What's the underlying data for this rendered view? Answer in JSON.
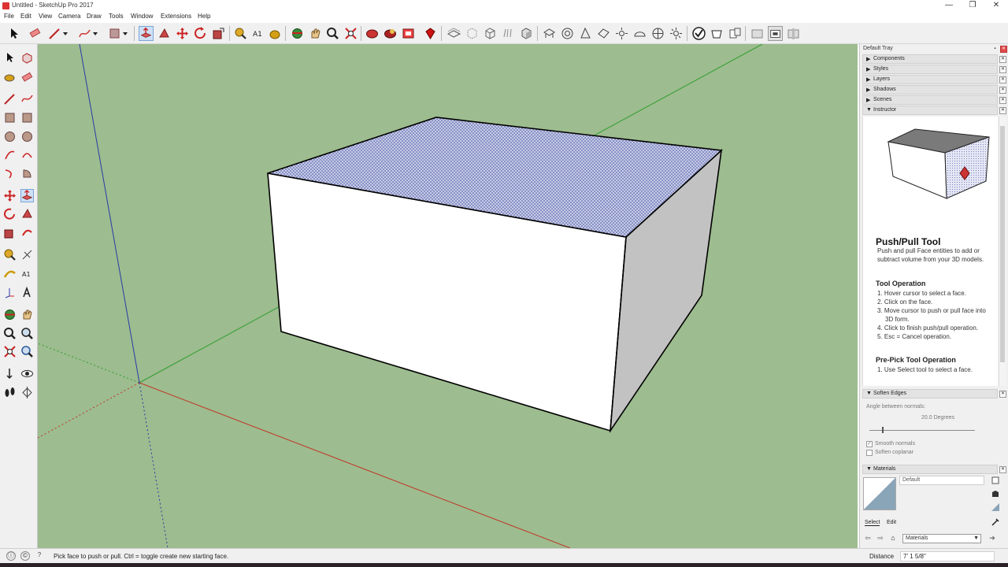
{
  "window": {
    "title": "Untitled - SketchUp Pro 2017",
    "minimize": "—",
    "restore": "❐",
    "close": "✕"
  },
  "menu": [
    "File",
    "Edit",
    "View",
    "Camera",
    "Draw",
    "Tools",
    "Window",
    "Extensions",
    "Help"
  ],
  "toolbar_icons": [
    "select-icon",
    "eraser-icon",
    "line-icon",
    "line-dropdown-icon",
    "freehand-icon",
    "arc-dropdown-icon",
    "paint-bucket-icon",
    "paint-dropdown-icon",
    "push-pull-icon",
    "follow-me-icon",
    "move-icon",
    "rotate-icon",
    "scale-icon",
    "tape-measure-icon",
    "text-icon",
    "paint-icon",
    "orbit-icon",
    "pan-icon",
    "zoom-icon",
    "zoom-extents-icon",
    "warehouse-icon",
    "extension-warehouse-icon",
    "layout-icon",
    "ruby-icon",
    "xray-icon",
    "back-edges-icon",
    "wireframe-icon",
    "hidden-line-icon",
    "shaded-icon",
    "shaded-textures-icon",
    "monochrome-icon",
    "iso-view-icon",
    "top-view-icon",
    "front-view-icon",
    "right-view-icon",
    "back-view-icon",
    "left-view-icon",
    "bottom-view-icon",
    "sandbox-icon",
    "solid-tools-icon",
    "section-plane-icon",
    "section-display-icon",
    "section-cut-icon"
  ],
  "left_tool_icons": [
    "select-icon",
    "make-component-icon",
    "paint-bucket-icon",
    "eraser-icon",
    "line-icon",
    "freehand-icon",
    "rectangle-icon",
    "rotated-rectangle-icon",
    "circle-icon",
    "polygon-icon",
    "arc-icon",
    "two-point-arc-icon",
    "three-point-arc-icon",
    "pie-icon",
    "move-icon",
    "push-pull-icon",
    "rotate-icon",
    "follow-me-icon",
    "scale-icon",
    "offset-icon",
    "tape-measure-icon",
    "dimension-icon",
    "protractor-icon",
    "text-icon",
    "axes-icon",
    "3d-text-icon",
    "orbit-icon",
    "pan-icon",
    "zoom-icon",
    "zoom-window-icon",
    "zoom-extents-icon",
    "previous-view-icon",
    "position-camera-icon",
    "look-around-icon",
    "walk-icon",
    "section-plane-icon"
  ],
  "tray": {
    "title": "Default Tray",
    "panels": [
      {
        "label": "Components",
        "expanded": false
      },
      {
        "label": "Styles",
        "expanded": false
      },
      {
        "label": "Layers",
        "expanded": false
      },
      {
        "label": "Shadows",
        "expanded": false
      },
      {
        "label": "Scenes",
        "expanded": false
      },
      {
        "label": "Instructor",
        "expanded": true
      }
    ],
    "instructor": {
      "title": "Push/Pull Tool",
      "description": "Push and pull Face entities to add or subtract volume from your 3D models.",
      "op_heading": "Tool Operation",
      "steps": [
        "1. Hover cursor to select a face.",
        "2. Click on the face.",
        "3. Move cursor to push or pull face into 3D form.",
        "4. Click to finish push/pull operation.",
        "5. Esc = Cancel operation."
      ],
      "prepick_heading": "Pre-Pick Tool Operation",
      "prepick_steps": [
        "1. Use Select tool to select a face."
      ]
    },
    "soften_edges": {
      "label": "Soften Edges",
      "angle_label": "Angle between normals:",
      "angle_value": "20.0 Degrees",
      "smooth_normals": "Smooth normals",
      "soften_coplanar": "Soften coplanar",
      "smooth_checked": true,
      "coplanar_checked": false,
      "slider_value_degrees": 20
    },
    "materials": {
      "label": "Materials",
      "name": "Default",
      "tab_select": "Select",
      "tab_edit": "Edit",
      "library": "Materials"
    }
  },
  "status": {
    "text": "Pick face to push or pull.  Ctrl = toggle create new starting face.",
    "measurements_label": "Distance",
    "measurements_value": "7' 1 5/8\""
  },
  "colors": {
    "viewport_bg": "#9dbc8f",
    "axis_red": "#c0392b",
    "axis_green": "#2f9e2f",
    "axis_blue": "#2a3aa8",
    "selected_face": "#b9bfe2"
  }
}
